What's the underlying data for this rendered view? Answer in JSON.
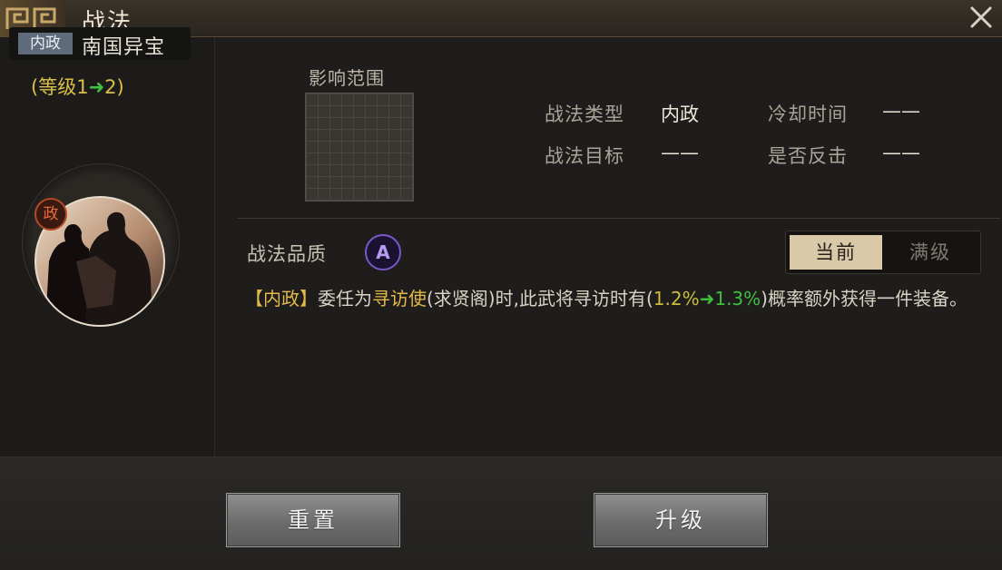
{
  "title": "战法",
  "skill": {
    "type_tag": "内政",
    "name": "南国异宝",
    "level_prefix": "(等级1",
    "level_arrow": "➜",
    "level_suffix": "2)",
    "portrait_badge": "政"
  },
  "range_label": "影响范围",
  "info": {
    "type_label": "战法类型",
    "type_value": "内政",
    "cooldown_label": "冷却时间",
    "cooldown_value": "——",
    "target_label": "战法目标",
    "target_value": "——",
    "counter_label": "是否反击",
    "counter_value": "——"
  },
  "quality": {
    "label": "战法品质",
    "grade": "A"
  },
  "toggle": {
    "current": "当前",
    "max": "满级",
    "selected": "current"
  },
  "description": {
    "tag": "【内政】",
    "part1": "委任为",
    "highlight": "寻访使",
    "part2": "(求贤阁)时,此武将寻访时有(",
    "value_from": "1.2%",
    "arrow": "➜",
    "value_to": "1.3%",
    "part3": ")概率额外获得一件装备。"
  },
  "buttons": {
    "reset": "重置",
    "upgrade": "升级"
  },
  "colors": {
    "accent_gold": "#e2b94a",
    "accent_green": "#3fbf3f",
    "quality_purple": "#7a58c8"
  }
}
